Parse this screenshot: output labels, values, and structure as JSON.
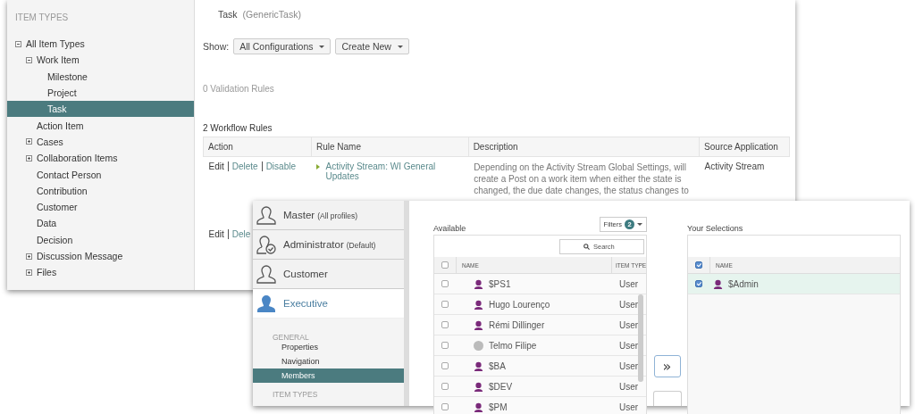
{
  "item_types_window": {
    "sidebar": {
      "title": "ITEM TYPES",
      "tree": [
        {
          "label": "All Item Types",
          "expanded": true,
          "selected": false,
          "children": [
            {
              "label": "Work Item",
              "expanded": true,
              "selected": false,
              "children": [
                {
                  "label": "Milestone",
                  "selected": false
                },
                {
                  "label": "Project",
                  "selected": false
                },
                {
                  "label": "Task",
                  "selected": true
                }
              ]
            },
            {
              "label": "Action Item",
              "selected": false
            },
            {
              "label": "Cases",
              "expanded": false,
              "selected": false
            },
            {
              "label": "Collaboration Items",
              "expanded": false,
              "selected": false
            },
            {
              "label": "Contact Person",
              "selected": false
            },
            {
              "label": "Contribution",
              "selected": false
            },
            {
              "label": "Customer",
              "selected": false
            },
            {
              "label": "Data",
              "selected": false
            },
            {
              "label": "Decision",
              "selected": false
            },
            {
              "label": "Discussion Message",
              "expanded": false,
              "selected": false
            },
            {
              "label": "Files",
              "expanded": false,
              "selected": false
            }
          ]
        }
      ]
    },
    "header": {
      "title": "Task",
      "subtitle": "(GenericTask)"
    },
    "show_label": "Show:",
    "dropdowns": [
      "All Configurations",
      "Create New"
    ],
    "validation_rules": "0 Validation Rules",
    "workflow_rules": "2 Workflow Rules",
    "table": {
      "columns": [
        "Action",
        "Rule Name",
        "Description",
        "Source Application"
      ],
      "rows": [
        {
          "actions": [
            "Edit",
            "Delete",
            "Disable"
          ],
          "rule_name": "Activity Stream: WI General Updates",
          "description": [
            "Depending on the Activity Stream Global Settings, will",
            "create a Post on a work item when either the state is",
            "changed, the due date changes, the status changes to"
          ],
          "source": "Activity Stream"
        },
        {
          "actions": [
            "Edit",
            "Dele"
          ]
        }
      ]
    }
  },
  "members_window": {
    "profiles": [
      {
        "name": "Master",
        "note": "(All profiles)",
        "kind": "user",
        "selected": false
      },
      {
        "name": "Administrator",
        "note": "(Default)",
        "kind": "user-check",
        "selected": false
      },
      {
        "name": "Customer",
        "kind": "user",
        "selected": false
      },
      {
        "name": "Executive",
        "kind": "user",
        "selected": true
      }
    ],
    "nav_sections": [
      {
        "title": "GENERAL",
        "items": [
          {
            "label": "Properties",
            "selected": false
          },
          {
            "label": "Navigation",
            "selected": false
          },
          {
            "label": "Members",
            "selected": true
          }
        ]
      },
      {
        "title": "ITEM TYPES"
      }
    ],
    "available": {
      "label": "Available",
      "filters": {
        "label": "Filters",
        "count": "2"
      },
      "search": {
        "placeholder": "Search"
      },
      "header_checked": false,
      "columns": [
        "NAME",
        "ITEM TYPE"
      ],
      "rows": [
        {
          "name": "$PS1",
          "type": "User",
          "kind": "user",
          "checked": false
        },
        {
          "name": "Hugo Lourenço",
          "type": "User",
          "kind": "user",
          "checked": false
        },
        {
          "name": "Rémi Dillinger",
          "type": "User",
          "kind": "user",
          "checked": false
        },
        {
          "name": "Telmo Filipe",
          "type": "User",
          "kind": "photo",
          "checked": false
        },
        {
          "name": "$BA",
          "type": "User",
          "kind": "user",
          "checked": false
        },
        {
          "name": "$DEV",
          "type": "User",
          "kind": "user",
          "checked": false
        },
        {
          "name": "$PM",
          "type": "User",
          "kind": "user",
          "checked": false
        }
      ]
    },
    "move_button": "»",
    "selections": {
      "label": "Your Selections",
      "header_checked": true,
      "columns": [
        "NAME"
      ],
      "rows": [
        {
          "name": "$Admin",
          "kind": "user",
          "checked": true
        }
      ]
    }
  }
}
